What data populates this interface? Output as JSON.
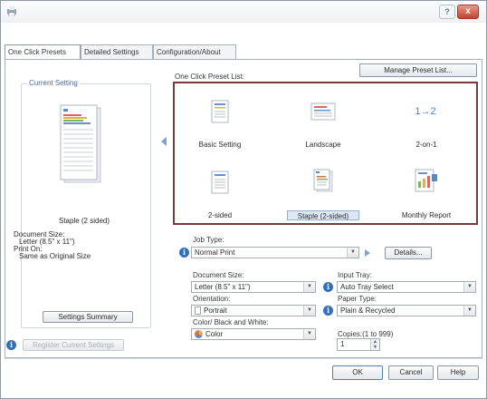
{
  "title_bar": {
    "help_label": "?",
    "close_label": "x"
  },
  "tabs": [
    {
      "label": "One Click Presets"
    },
    {
      "label": "Detailed Settings"
    },
    {
      "label": "Configuration/About"
    }
  ],
  "current_setting": {
    "caption": "Current Setting",
    "preset_name": "Staple (2 sided)",
    "document_size_label": "Document Size:",
    "document_size_value": "Letter (8.5\" x 11\")",
    "print_on_label": "Print On:",
    "print_on_value": "Same as Original Size",
    "settings_summary_button": "Settings Summary",
    "register_button": "Register Current Settings"
  },
  "preset_list": {
    "label": "One Click Preset List:",
    "manage_button": "Manage Preset List...",
    "items": [
      {
        "label": "Basic Setting",
        "icon": "document-icon"
      },
      {
        "label": "Landscape",
        "icon": "landscape-document-icon"
      },
      {
        "label": "2-on-1",
        "icon": "two-on-one-icon",
        "icon_text": "1→2"
      },
      {
        "label": "2-sided",
        "icon": "document-icon"
      },
      {
        "label": "Staple (2-sided)",
        "icon": "stapled-document-icon",
        "selected": true
      },
      {
        "label": "Monthly Report",
        "icon": "report-icon"
      }
    ]
  },
  "job_type": {
    "label": "Job Type:",
    "value": "Normal Print",
    "details_button": "Details..."
  },
  "document_size": {
    "label": "Document Size:",
    "value": "Letter (8.5\" x 11\")"
  },
  "input_tray": {
    "label": "Input Tray:",
    "value": "Auto Tray Select"
  },
  "orientation": {
    "label": "Orientation:",
    "value": "Portrait"
  },
  "paper_type": {
    "label": "Paper Type:",
    "value": "Plain & Recycled"
  },
  "color_mode": {
    "label": "Color/ Black and White:",
    "value": "Color"
  },
  "copies": {
    "label": "Copies:(1 to 999)",
    "value": "1"
  },
  "footer": {
    "ok": "OK",
    "cancel": "Cancel",
    "help": "Help"
  },
  "colors": {
    "accent": "#2f6fc4",
    "preset_border": "#7b3a3a",
    "selection": "#dde8f5"
  }
}
